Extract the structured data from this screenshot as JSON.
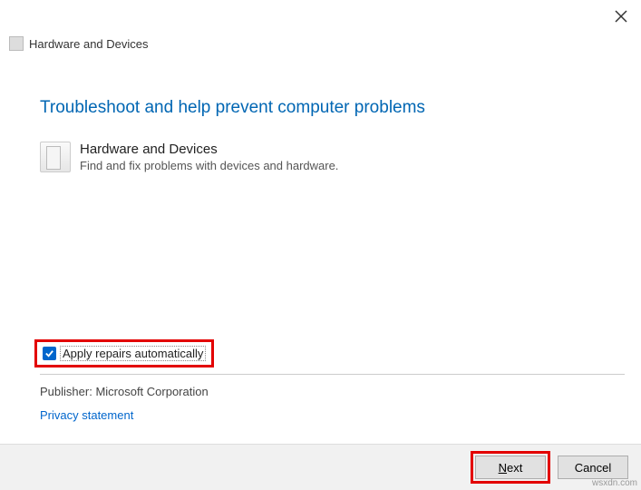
{
  "window": {
    "title": "Hardware and Devices"
  },
  "main": {
    "heading": "Troubleshoot and help prevent computer problems",
    "item": {
      "title": "Hardware and Devices",
      "description": "Find and fix problems with devices and hardware."
    }
  },
  "checkbox": {
    "label": "Apply repairs automatically",
    "checked": true
  },
  "publisher": {
    "label": "Publisher:",
    "value": "Microsoft Corporation"
  },
  "links": {
    "privacy": "Privacy statement"
  },
  "footer": {
    "next_prefix": "N",
    "next_rest": "ext",
    "cancel": "Cancel"
  },
  "watermark": "wsxdn.com"
}
